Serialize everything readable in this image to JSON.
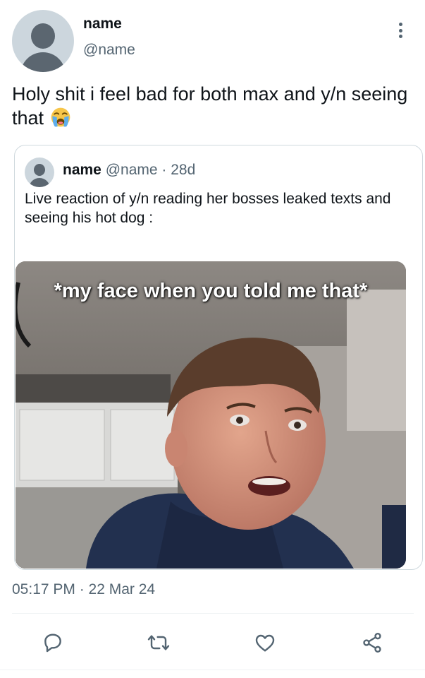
{
  "tweet": {
    "display_name": "name",
    "handle": "@name",
    "text": "Holy shit i feel bad for both max and y/n seeing that",
    "emoji": "loudly-crying-face",
    "timestamp": "05:17 PM · 22 Mar 24"
  },
  "quoted_tweet": {
    "display_name": "name",
    "handle": "@name",
    "separator": "·",
    "age": "28d",
    "text": "Live reaction of y/n reading her bosses leaked texts and seeing his hot dog :",
    "media_caption": "*my face when you told me that*"
  },
  "actions": [
    {
      "icon": "reply-icon"
    },
    {
      "icon": "retweet-icon"
    },
    {
      "icon": "like-icon"
    },
    {
      "icon": "share-icon"
    }
  ],
  "colors": {
    "primary_text": "#0f1419",
    "secondary_text": "#536471",
    "border": "#cfd9de",
    "avatar_bg": "#ccd6dd"
  }
}
